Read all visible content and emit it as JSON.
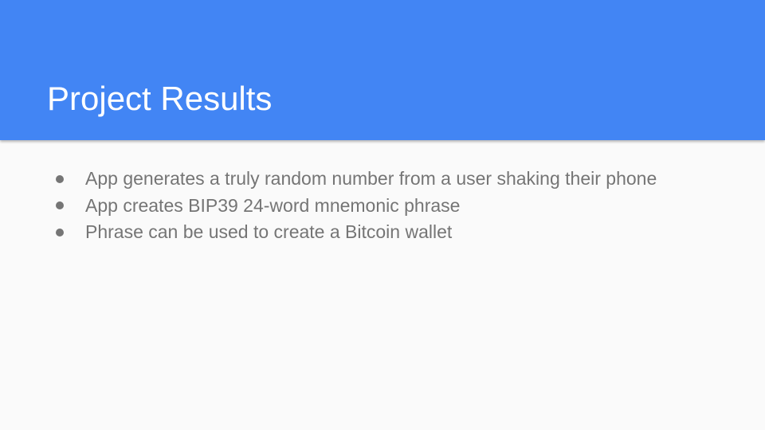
{
  "slide": {
    "title": "Project Results",
    "bullets": [
      "App generates a truly random number from a user shaking their phone",
      "App creates BIP39 24-word mnemonic phrase",
      "Phrase can be used to create a Bitcoin wallet"
    ]
  },
  "colors": {
    "header": "#4285f4",
    "background": "#fafafa",
    "title_text": "#ffffff",
    "body_text": "#757575"
  }
}
